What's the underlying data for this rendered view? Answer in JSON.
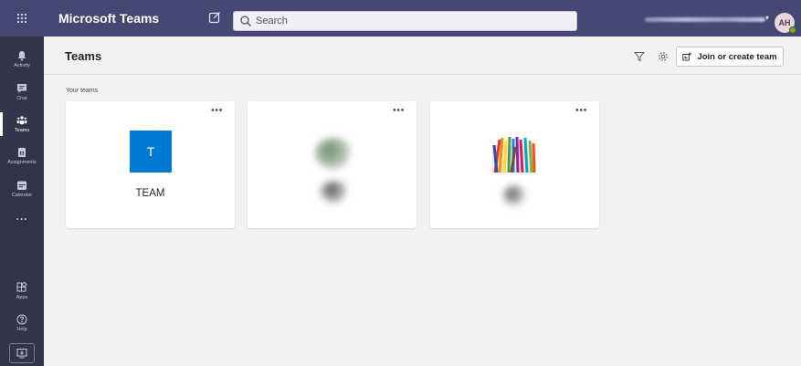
{
  "app": {
    "title": "Microsoft Teams"
  },
  "search": {
    "placeholder": "Search"
  },
  "account": {
    "initials": "AH"
  },
  "rail": {
    "items": [
      {
        "label": "Activity",
        "icon": "bell-icon"
      },
      {
        "label": "Chat",
        "icon": "chat-icon"
      },
      {
        "label": "Teams",
        "icon": "teams-icon",
        "active": true
      },
      {
        "label": "Assignments",
        "icon": "assignments-icon"
      },
      {
        "label": "Calendar",
        "icon": "calendar-icon"
      }
    ],
    "more": "...",
    "bottom": [
      {
        "label": "Apps",
        "icon": "apps-icon"
      },
      {
        "label": "Help",
        "icon": "help-icon"
      }
    ]
  },
  "header": {
    "title": "Teams",
    "join_label": "Join or create team"
  },
  "section": {
    "label": "Your teams"
  },
  "cards": [
    {
      "tile_letter": "T",
      "name": "TEAM",
      "tile_color": "#0078d4"
    },
    {
      "name": ""
    },
    {
      "name": ""
    }
  ],
  "colors": {
    "topbar": "#464775",
    "rail": "#33344a",
    "accent": "#0078d4",
    "presence": "#6bb700"
  }
}
